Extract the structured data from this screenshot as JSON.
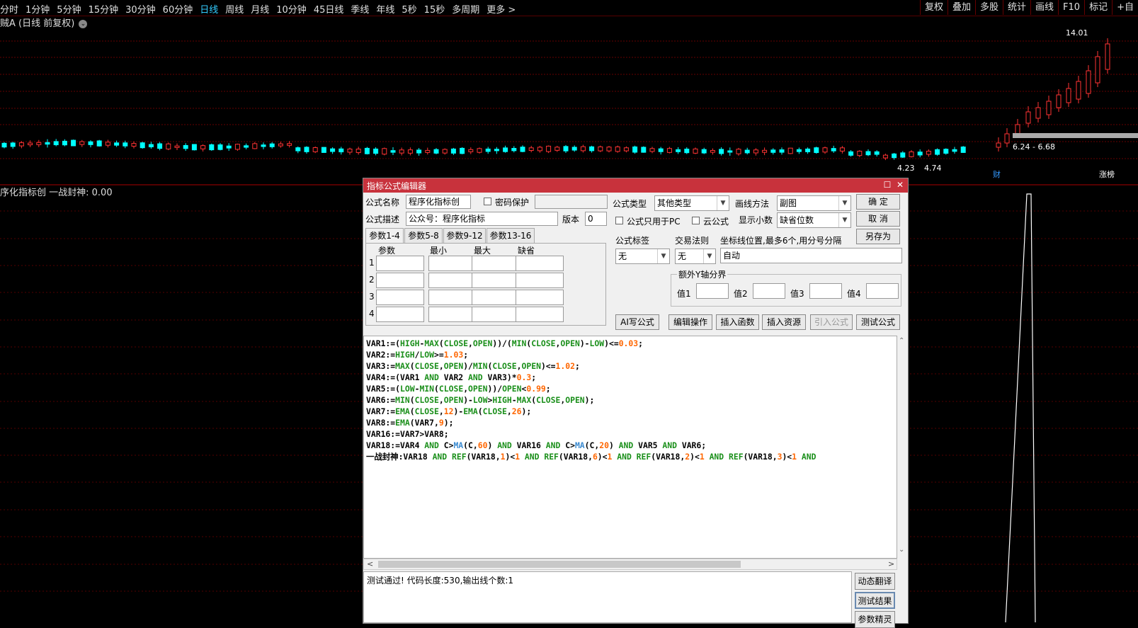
{
  "toolbar": {
    "periods": [
      "分时",
      "1分钟",
      "5分钟",
      "15分钟",
      "30分钟",
      "60分钟",
      "日线",
      "周线",
      "月线",
      "10分钟",
      "45日线",
      "季线",
      "年线",
      "5秒",
      "15秒",
      "多周期",
      "更多 >"
    ],
    "active_period": "日线",
    "right_buttons": [
      "复权",
      "叠加",
      "多股",
      "统计",
      "画线",
      "F10",
      "标记",
      "+自"
    ]
  },
  "main_chart": {
    "stock_label": "贼A (日线 前复权)",
    "dropdown_icon": "chevron-down-icon",
    "price_high_label": "14.01",
    "price_low_label": "4.23",
    "price_low_label2": "4.74",
    "range_label": "6.24 - 6.68",
    "event_markers": [
      "财",
      "涨榜",
      "跌"
    ],
    "up_color": "#ff3333",
    "down_color": "#00ffff",
    "grid_color": "#660000"
  },
  "indicator_pane": {
    "label": "序化指标创 一战封神: 0.00"
  },
  "dialog": {
    "title": "指标公式编辑器",
    "name_label": "公式名称",
    "name_value": "程序化指标创",
    "password_label": "密码保护",
    "desc_label": "公式描述",
    "desc_value": "公众号：程序化指标",
    "version_label": "版本",
    "version_value": "0",
    "type_label": "公式类型",
    "type_value": "其他类型",
    "draw_label": "画线方法",
    "draw_value": "副图",
    "pc_only_label": "公式只用于PC",
    "cloud_label": "云公式",
    "decimals_label": "显示小数",
    "decimals_value": "缺省位数",
    "ok_label": "确  定",
    "cancel_label": "取  消",
    "saveas_label": "另存为",
    "param_tabs": [
      "参数1-4",
      "参数5-8",
      "参数9-12",
      "参数13-16"
    ],
    "param_headers": [
      "参数",
      "最小",
      "最大",
      "缺省"
    ],
    "param_rows": [
      "1",
      "2",
      "3",
      "4"
    ],
    "formula_tag_label": "公式标签",
    "formula_tag_value": "无",
    "trade_rule_label": "交易法则",
    "trade_rule_value": "无",
    "coord_label": "坐标线位置,最多6个,用分号分隔",
    "coord_value": "自动",
    "yaxis_group_label": "额外Y轴分界",
    "yaxis_values": [
      "值1",
      "值2",
      "值3",
      "值4"
    ],
    "buttons": [
      "AI写公式",
      "编辑操作",
      "插入函数",
      "插入资源",
      "引入公式",
      "测试公式"
    ],
    "code_lines": [
      "VAR1:=(HIGH-MAX(CLOSE,OPEN))/(MIN(CLOSE,OPEN)-LOW)<=0.03;",
      "VAR2:=HIGH/LOW>=1.03;",
      "VAR3:=MAX(CLOSE,OPEN)/MIN(CLOSE,OPEN)<=1.02;",
      "VAR4:=(VAR1 AND VAR2 AND VAR3)*0.3;",
      "VAR5:=(LOW-MIN(CLOSE,OPEN))/OPEN<0.99;",
      "VAR6:=MIN(CLOSE,OPEN)-LOW>HIGH-MAX(CLOSE,OPEN);",
      "VAR7:=EMA(CLOSE,12)-EMA(CLOSE,26);",
      "VAR8:=EMA(VAR7,9);",
      "VAR16:=VAR7>VAR8;",
      "VAR18:=VAR4 AND C>MA(C,60) AND VAR16 AND C>MA(C,20) AND VAR5 AND VAR6;",
      "一战封神:VAR18 AND REF(VAR18,1)<1 AND REF(VAR18,6)<1 AND REF(VAR18,2)<1 AND REF(VAR18,3)<1 AND"
    ],
    "result_text": "测试通过! 代码长度:530,输出线个数:1",
    "side_buttons": [
      "动态翻译",
      "测试结果",
      "参数精灵"
    ]
  }
}
